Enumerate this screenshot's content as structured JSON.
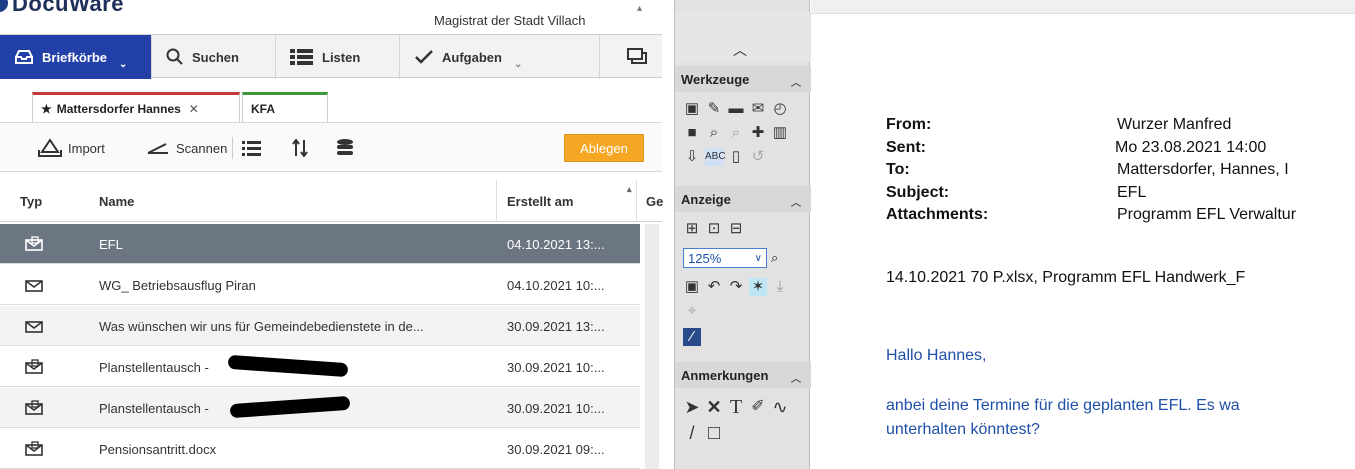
{
  "app": {
    "logo_text": "DocuWare",
    "organization": "Magistrat der Stadt Villach"
  },
  "nav": {
    "items": [
      {
        "label": "Briefkörbe",
        "icon": "inbox-icon"
      },
      {
        "label": "Suchen",
        "icon": "search-icon"
      },
      {
        "label": "Listen",
        "icon": "list-icon"
      },
      {
        "label": "Aufgaben",
        "icon": "checkmark-icon"
      }
    ]
  },
  "tabs": [
    {
      "label": "Mattersdorfer Hannes",
      "color": "#c63a3a"
    },
    {
      "label": "KFA",
      "color": "#3a9a3a"
    }
  ],
  "toolbar": {
    "import_label": "Import",
    "scan_label": "Scannen",
    "store_label": "Ablegen"
  },
  "table": {
    "headers": [
      "Typ",
      "Name",
      "Erstellt am",
      "Ge"
    ],
    "rows": [
      {
        "name": "EFL",
        "created": "04.10.2021 13:...",
        "icon": "mail-attachment-icon",
        "selected": true
      },
      {
        "name": "WG_ Betriebsausflug Piran",
        "created": "04.10.2021 10:...",
        "icon": "mail-icon"
      },
      {
        "name": "Was wünschen wir uns für Gemeindebedienstete in de...",
        "created": "30.09.2021 13:...",
        "icon": "mail-icon"
      },
      {
        "name": "Planstellentausch -",
        "created": "30.09.2021 10:...",
        "icon": "mail-attachment-icon",
        "redacted": true
      },
      {
        "name": "Planstellentausch -",
        "created": "30.09.2021 10:...",
        "icon": "mail-attachment-icon",
        "redacted": true
      },
      {
        "name": "Pensionsantritt.docx",
        "created": "30.09.2021 09:...",
        "icon": "mail-attachment-icon"
      }
    ]
  },
  "tools": {
    "sections": [
      "Werkzeuge",
      "Anzeige",
      "Anmerkungen"
    ],
    "zoom": "125%"
  },
  "preview": {
    "fields": [
      {
        "label": "From:",
        "value": "Wurzer Manfred"
      },
      {
        "label": "Sent:",
        "value": "Mo 23.08.2021 14:00"
      },
      {
        "label": "To:",
        "value": "Mattersdorfer, Hannes, I"
      },
      {
        "label": "Subject:",
        "value": "EFL"
      },
      {
        "label": "Attachments:",
        "value": "Programm EFL Verwaltur"
      }
    ],
    "attachments_cont": "14.10.2021 70 P.xlsx, Programm EFL Handwerk_F",
    "greeting": "Hallo Hannes,",
    "body_line1": "anbei deine Termine für die geplanten EFL. Es wa",
    "body_line2": "unterhalten könntest?"
  },
  "colors": {
    "nav_active": "#2340a8",
    "store_button": "#f5a623",
    "selected_row": "#6c7682",
    "mail_text_blue": "#1f4fa8"
  }
}
